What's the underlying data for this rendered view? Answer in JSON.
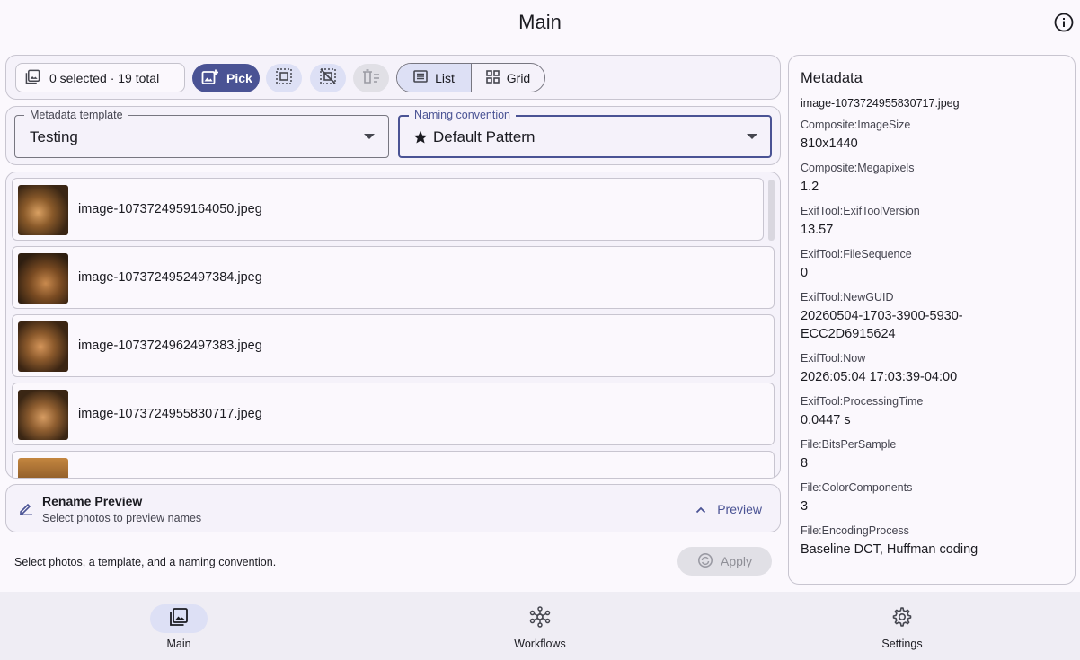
{
  "app": {
    "title": "Main"
  },
  "toolbar": {
    "count_label": "0 selected · 19 total",
    "pick_label": "Pick",
    "select_all_icon": "select-all-icon",
    "deselect_icon": "deselect-icon",
    "clear_icon": "clear-list-icon",
    "view_list_label": "List",
    "view_grid_label": "Grid",
    "selected_view": "List"
  },
  "template": {
    "label": "Metadata template",
    "value": "Testing"
  },
  "naming": {
    "label": "Naming convention",
    "value": "Default Pattern",
    "icon": "star-icon"
  },
  "files": [
    {
      "name": "image-1073724959164050.jpeg"
    },
    {
      "name": "image-1073724952497384.jpeg"
    },
    {
      "name": "image-1073724962497383.jpeg"
    },
    {
      "name": "image-1073724955830717.jpeg"
    },
    {
      "name": ""
    }
  ],
  "rename": {
    "title": "Rename Preview",
    "subtitle": "Select photos to preview names",
    "preview_label": "Preview"
  },
  "footer": {
    "hint": "Select photos, a template, and a naming convention.",
    "apply_label": "Apply"
  },
  "metadata": {
    "title": "Metadata",
    "filename": "image-1073724955830717.jpeg",
    "entries": [
      {
        "key": "Composite:ImageSize",
        "value": "810x1440"
      },
      {
        "key": "Composite:Megapixels",
        "value": "1.2"
      },
      {
        "key": "ExifTool:ExifToolVersion",
        "value": "13.57"
      },
      {
        "key": "ExifTool:FileSequence",
        "value": "0"
      },
      {
        "key": "ExifTool:NewGUID",
        "value": "20260504-1703-3900-5930-ECC2D6915624"
      },
      {
        "key": "ExifTool:Now",
        "value": "2026:05:04 17:03:39-04:00"
      },
      {
        "key": "ExifTool:ProcessingTime",
        "value": "0.0447 s"
      },
      {
        "key": "File:BitsPerSample",
        "value": "8"
      },
      {
        "key": "File:ColorComponents",
        "value": "3"
      },
      {
        "key": "File:EncodingProcess",
        "value": "Baseline DCT, Huffman coding"
      }
    ]
  },
  "nav": [
    {
      "label": "Main",
      "icon": "photo-library-icon",
      "active": true
    },
    {
      "label": "Workflows",
      "icon": "workflow-hub-icon",
      "active": false
    },
    {
      "label": "Settings",
      "icon": "gear-icon",
      "active": false
    }
  ],
  "colors": {
    "accent": "#4a5394",
    "accent_container": "#dde0f5",
    "surface": "#fbf8fd",
    "panel": "#f5f2fa",
    "outline": "#c8c5d0"
  }
}
